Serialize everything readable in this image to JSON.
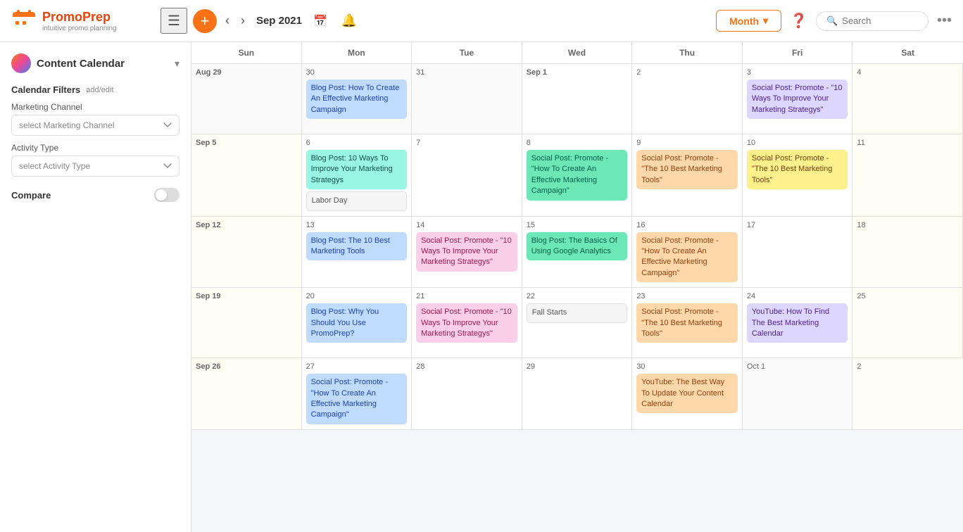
{
  "topbar": {
    "logo_brand": "PromoPrep",
    "logo_sub": "intuitive promo planning",
    "current_date": "Sep 2021",
    "month_btn_label": "Month",
    "search_placeholder": "Search",
    "help_label": "?"
  },
  "sidebar": {
    "title": "Content Calendar",
    "filters_title": "Calendar Filters",
    "filters_link": "add/edit",
    "marketing_label": "Marketing Channel",
    "marketing_placeholder": "select Marketing Channel",
    "activity_label": "Activity Type",
    "activity_placeholder": "select Activity Type",
    "compare_label": "Compare"
  },
  "day_headers": [
    "Sun",
    "Mon",
    "Tue",
    "Wed",
    "Thu",
    "Fri",
    "Sat"
  ],
  "weeks": [
    {
      "cells": [
        {
          "week_label": "Aug 29",
          "date": "",
          "events": [],
          "other": true
        },
        {
          "date": "30",
          "events": [
            {
              "label": "Blog Post: How To Create An Effective Marketing Campaign",
              "type": "blue"
            }
          ],
          "other": true
        },
        {
          "date": "31",
          "events": [],
          "other": true
        },
        {
          "week_label": "Sep 1",
          "date": "",
          "events": []
        },
        {
          "date": "2",
          "events": []
        },
        {
          "date": "3",
          "events": [
            {
              "label": "Social Post: Promote - \"10 Ways To Improve Your Marketing Strategys\"",
              "type": "purple"
            }
          ]
        },
        {
          "date": "4",
          "events": [],
          "weekend": true
        }
      ]
    },
    {
      "cells": [
        {
          "week_label": "Sep 5",
          "date": "",
          "events": [],
          "weekend": true
        },
        {
          "date": "6",
          "events": [
            {
              "label": "Blog Post: 10 Ways To Improve Your Marketing Strategys",
              "type": "teal"
            },
            {
              "label": "Labor Day",
              "type": "holiday"
            }
          ]
        },
        {
          "date": "7",
          "events": []
        },
        {
          "date": "8",
          "events": [
            {
              "label": "Social Post: Promote - \"How To Create An Effective Marketing Campaign\"",
              "type": "green"
            }
          ]
        },
        {
          "date": "9",
          "events": [
            {
              "label": "Social Post: Promote - \"The 10 Best Marketing Tools\"",
              "type": "orange"
            }
          ]
        },
        {
          "date": "10",
          "events": [
            {
              "label": "Social Post: Promote - \"The 10 Best Marketing Tools\"",
              "type": "yellow"
            }
          ]
        },
        {
          "date": "11",
          "events": [],
          "weekend": true
        }
      ]
    },
    {
      "cells": [
        {
          "week_label": "Sep 12",
          "date": "",
          "events": [],
          "weekend": true
        },
        {
          "date": "13",
          "events": [
            {
              "label": "Blog Post: The 10 Best Marketing Tools",
              "type": "blue"
            }
          ]
        },
        {
          "date": "14",
          "events": [
            {
              "label": "Social Post: Promote - \"10 Ways To Improve Your Marketing Strategys\"",
              "type": "pink"
            }
          ]
        },
        {
          "date": "15",
          "events": [
            {
              "label": "Blog Post: The Basics Of Using Google Analytics",
              "type": "green"
            }
          ]
        },
        {
          "date": "16",
          "events": [
            {
              "label": "Social Post: Promote - \"How To Create An Effective Marketing Campaign\"",
              "type": "orange"
            }
          ]
        },
        {
          "date": "17",
          "events": []
        },
        {
          "date": "18",
          "events": [],
          "weekend": true
        }
      ]
    },
    {
      "cells": [
        {
          "week_label": "Sep 19",
          "date": "",
          "events": [],
          "weekend": true
        },
        {
          "date": "20",
          "events": [
            {
              "label": "Blog Post: Why You Should You Use PromoPrep?",
              "type": "blue"
            }
          ]
        },
        {
          "date": "21",
          "events": [
            {
              "label": "Social Post: Promote - \"10 Ways To Improve Your Marketing Strategys\"",
              "type": "pink"
            }
          ]
        },
        {
          "date": "22",
          "events": [
            {
              "label": "Fall Starts",
              "type": "holiday"
            }
          ]
        },
        {
          "date": "23",
          "events": [
            {
              "label": "Social Post: Promote - \"The 10 Best Marketing Tools\"",
              "type": "orange"
            }
          ]
        },
        {
          "date": "24",
          "events": [
            {
              "label": "YouTube: How To Find The Best Marketing Calendar",
              "type": "purple"
            }
          ]
        },
        {
          "date": "25",
          "events": [],
          "weekend": true
        }
      ]
    },
    {
      "cells": [
        {
          "week_label": "Sep 26",
          "date": "",
          "events": [],
          "weekend": true
        },
        {
          "date": "27",
          "events": [
            {
              "label": "Social Post: Promote - \"How To Create An Effective Marketing Campaign\"",
              "type": "blue"
            }
          ]
        },
        {
          "date": "28",
          "events": []
        },
        {
          "date": "29",
          "events": [],
          "light": true
        },
        {
          "date": "30",
          "events": [
            {
              "label": "YouTube: The Best Way To Update Your Content Calendar",
              "type": "orange"
            }
          ]
        },
        {
          "date": "Oct 1",
          "events": [],
          "other": true
        },
        {
          "date": "2",
          "events": [],
          "other": true,
          "weekend": true
        }
      ]
    }
  ]
}
